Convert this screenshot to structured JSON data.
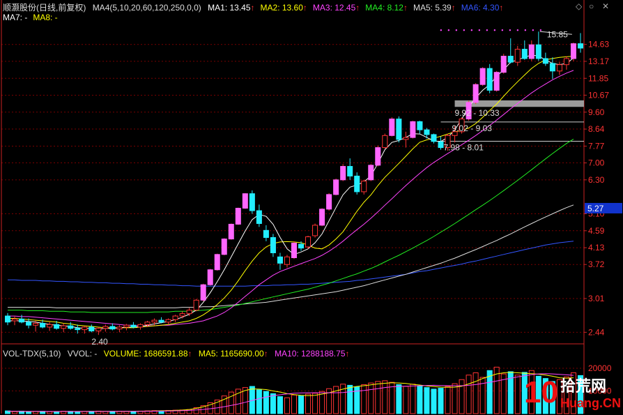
{
  "header": {
    "stock_label": "顺灏股份",
    "period": "(日线,前复权)",
    "ma_config": "MA4(5,10,20,60,120,250,0,0)",
    "ma_values": [
      {
        "label": "MA1:",
        "value": "13.45",
        "color": "#ffffff"
      },
      {
        "label": "MA2:",
        "value": "13.60",
        "color": "#ffff00"
      },
      {
        "label": "MA3:",
        "value": "12.45",
        "color": "#ff44ff"
      },
      {
        "label": "MA4:",
        "value": "8.12",
        "color": "#22ee22"
      },
      {
        "label": "MA5:",
        "value": "5.39",
        "color": "#dddddd"
      },
      {
        "label": "MA6:",
        "value": "4.30",
        "color": "#3355ff"
      }
    ],
    "ma_values_row2": [
      {
        "label": "MA7:",
        "value": "-",
        "color": "#ffffff"
      },
      {
        "label": "MA8:",
        "value": "-",
        "color": "#ffff00"
      }
    ],
    "up_arrow": "↑",
    "nav_buttons": [
      "◇",
      "○",
      "✕"
    ]
  },
  "volume_header": {
    "title": "VOL-TDX(5,10)",
    "vvol": "VVOL: -",
    "volume": {
      "label": "VOLUME:",
      "value": "1686591.88",
      "color": "#ffff00"
    },
    "ma5": {
      "label": "MA5:",
      "value": "1165690.00",
      "color": "#ffff00"
    },
    "ma10": {
      "label": "MA10:",
      "value": "1288188.75",
      "color": "#ff44ff"
    }
  },
  "price_axis_labels": [
    "14.63",
    "13.17",
    "11.85",
    "10.67",
    "9.60",
    "8.64",
    "7.77",
    "7.00",
    "6.30",
    "5.10",
    "4.59",
    "4.13",
    "3.72",
    "3.01",
    "2.44"
  ],
  "current_price_tag": "5.27",
  "volume_axis_labels": [
    "20000",
    "10000"
  ],
  "annotations": {
    "high": "15.85",
    "low": "2.40",
    "zone1": "9.92 - 10.33",
    "zone2": "9.02 - 9.03",
    "zone3": "7.98 - 8.01"
  },
  "watermark": {
    "brand_num": "10",
    "brand_name": "拾荒网",
    "url": "Huang.CN"
  },
  "colors": {
    "up": "#ff3333",
    "up_fill": "#ff66ff",
    "down": "#22eeff",
    "ma1": "#ffffff",
    "ma2": "#ffff00",
    "ma3": "#ff44ff",
    "ma4": "#22ee22",
    "ma5": "#dddddd",
    "ma6": "#3355ff",
    "grid": "#7a0000",
    "axis": "#cc2222"
  },
  "chart_data": {
    "type": "candlestick",
    "y_scale": "log",
    "ylim": [
      2.3,
      16.5
    ],
    "candles": [
      {
        "o": 2.7,
        "h": 2.75,
        "l": 2.55,
        "c": 2.6
      },
      {
        "o": 2.62,
        "h": 2.7,
        "l": 2.55,
        "c": 2.65
      },
      {
        "o": 2.65,
        "h": 2.72,
        "l": 2.58,
        "c": 2.6
      },
      {
        "o": 2.6,
        "h": 2.66,
        "l": 2.5,
        "c": 2.55
      },
      {
        "o": 2.55,
        "h": 2.62,
        "l": 2.45,
        "c": 2.58
      },
      {
        "o": 2.58,
        "h": 2.64,
        "l": 2.5,
        "c": 2.52
      },
      {
        "o": 2.52,
        "h": 2.6,
        "l": 2.46,
        "c": 2.56
      },
      {
        "o": 2.56,
        "h": 2.62,
        "l": 2.48,
        "c": 2.5
      },
      {
        "o": 2.5,
        "h": 2.58,
        "l": 2.44,
        "c": 2.54
      },
      {
        "o": 2.54,
        "h": 2.6,
        "l": 2.48,
        "c": 2.5
      },
      {
        "o": 2.5,
        "h": 2.56,
        "l": 2.42,
        "c": 2.48
      },
      {
        "o": 2.48,
        "h": 2.54,
        "l": 2.42,
        "c": 2.52
      },
      {
        "o": 2.52,
        "h": 2.56,
        "l": 2.44,
        "c": 2.46
      },
      {
        "o": 2.46,
        "h": 2.52,
        "l": 2.4,
        "c": 2.5
      },
      {
        "o": 2.5,
        "h": 2.56,
        "l": 2.45,
        "c": 2.53
      },
      {
        "o": 2.53,
        "h": 2.58,
        "l": 2.47,
        "c": 2.49
      },
      {
        "o": 2.49,
        "h": 2.55,
        "l": 2.44,
        "c": 2.52
      },
      {
        "o": 2.52,
        "h": 2.57,
        "l": 2.47,
        "c": 2.55
      },
      {
        "o": 2.55,
        "h": 2.6,
        "l": 2.5,
        "c": 2.52
      },
      {
        "o": 2.52,
        "h": 2.58,
        "l": 2.48,
        "c": 2.56
      },
      {
        "o": 2.56,
        "h": 2.62,
        "l": 2.52,
        "c": 2.6
      },
      {
        "o": 2.6,
        "h": 2.66,
        "l": 2.55,
        "c": 2.63
      },
      {
        "o": 2.63,
        "h": 2.68,
        "l": 2.58,
        "c": 2.6
      },
      {
        "o": 2.6,
        "h": 2.66,
        "l": 2.56,
        "c": 2.64
      },
      {
        "o": 2.64,
        "h": 2.72,
        "l": 2.6,
        "c": 2.7
      },
      {
        "o": 2.7,
        "h": 2.78,
        "l": 2.66,
        "c": 2.74
      },
      {
        "o": 2.74,
        "h": 2.84,
        "l": 2.7,
        "c": 2.8
      },
      {
        "o": 2.8,
        "h": 3.0,
        "l": 2.78,
        "c": 2.98
      },
      {
        "o": 2.98,
        "h": 3.3,
        "l": 2.96,
        "c": 3.28
      },
      {
        "o": 3.28,
        "h": 3.62,
        "l": 3.26,
        "c": 3.6
      },
      {
        "o": 3.6,
        "h": 3.98,
        "l": 3.58,
        "c": 3.96
      },
      {
        "o": 3.96,
        "h": 4.38,
        "l": 3.94,
        "c": 4.36
      },
      {
        "o": 4.36,
        "h": 4.8,
        "l": 4.34,
        "c": 4.78
      },
      {
        "o": 4.78,
        "h": 5.3,
        "l": 4.76,
        "c": 5.28
      },
      {
        "o": 5.28,
        "h": 5.8,
        "l": 5.26,
        "c": 5.78
      },
      {
        "o": 5.78,
        "h": 5.9,
        "l": 5.1,
        "c": 5.2
      },
      {
        "o": 5.2,
        "h": 5.4,
        "l": 4.7,
        "c": 4.8
      },
      {
        "o": 4.6,
        "h": 4.75,
        "l": 4.3,
        "c": 4.4
      },
      {
        "o": 4.4,
        "h": 4.5,
        "l": 3.9,
        "c": 4.0
      },
      {
        "o": 3.9,
        "h": 4.0,
        "l": 3.6,
        "c": 3.75
      },
      {
        "o": 3.72,
        "h": 3.95,
        "l": 3.65,
        "c": 3.9
      },
      {
        "o": 3.88,
        "h": 4.3,
        "l": 3.85,
        "c": 4.25
      },
      {
        "o": 4.22,
        "h": 4.3,
        "l": 4.05,
        "c": 4.12
      },
      {
        "o": 4.15,
        "h": 4.45,
        "l": 4.1,
        "c": 4.42
      },
      {
        "o": 4.45,
        "h": 4.8,
        "l": 4.4,
        "c": 4.75
      },
      {
        "o": 4.75,
        "h": 5.28,
        "l": 4.72,
        "c": 5.25
      },
      {
        "o": 5.25,
        "h": 5.8,
        "l": 5.2,
        "c": 5.75
      },
      {
        "o": 5.75,
        "h": 6.35,
        "l": 5.72,
        "c": 6.3
      },
      {
        "o": 6.3,
        "h": 6.95,
        "l": 6.25,
        "c": 6.85
      },
      {
        "o": 6.85,
        "h": 7.2,
        "l": 6.3,
        "c": 6.45
      },
      {
        "o": 6.45,
        "h": 6.6,
        "l": 5.75,
        "c": 5.85
      },
      {
        "o": 5.85,
        "h": 6.3,
        "l": 5.75,
        "c": 6.25
      },
      {
        "o": 6.3,
        "h": 6.95,
        "l": 6.25,
        "c": 6.9
      },
      {
        "o": 6.9,
        "h": 7.8,
        "l": 6.85,
        "c": 7.7
      },
      {
        "o": 7.7,
        "h": 8.4,
        "l": 7.65,
        "c": 8.3
      },
      {
        "o": 8.3,
        "h": 9.3,
        "l": 8.25,
        "c": 9.2
      },
      {
        "o": 9.2,
        "h": 9.35,
        "l": 7.95,
        "c": 8.1
      },
      {
        "o": 8.1,
        "h": 8.5,
        "l": 7.7,
        "c": 8.2
      },
      {
        "o": 8.2,
        "h": 9.1,
        "l": 8.15,
        "c": 9.05
      },
      {
        "o": 9.05,
        "h": 9.1,
        "l": 8.4,
        "c": 8.6
      },
      {
        "o": 8.6,
        "h": 8.7,
        "l": 8.15,
        "c": 8.35
      },
      {
        "o": 8.35,
        "h": 8.4,
        "l": 7.9,
        "c": 8.0
      },
      {
        "o": 7.98,
        "h": 8.25,
        "l": 7.6,
        "c": 7.7
      },
      {
        "o": 7.7,
        "h": 8.4,
        "l": 7.55,
        "c": 8.3
      },
      {
        "o": 8.3,
        "h": 8.8,
        "l": 7.95,
        "c": 8.5
      },
      {
        "o": 8.5,
        "h": 9.3,
        "l": 8.4,
        "c": 9.2
      },
      {
        "o": 9.2,
        "h": 10.3,
        "l": 9.1,
        "c": 10.2
      },
      {
        "o": 10.2,
        "h": 11.5,
        "l": 10.1,
        "c": 11.4
      },
      {
        "o": 11.4,
        "h": 12.7,
        "l": 11.3,
        "c": 12.6
      },
      {
        "o": 12.6,
        "h": 12.95,
        "l": 10.8,
        "c": 11.0
      },
      {
        "o": 11.0,
        "h": 12.4,
        "l": 10.9,
        "c": 12.3
      },
      {
        "o": 12.3,
        "h": 13.8,
        "l": 12.2,
        "c": 13.6
      },
      {
        "o": 13.6,
        "h": 15.2,
        "l": 13.0,
        "c": 13.1
      },
      {
        "o": 13.1,
        "h": 14.5,
        "l": 12.8,
        "c": 14.2
      },
      {
        "o": 14.2,
        "h": 15.0,
        "l": 13.3,
        "c": 13.4
      },
      {
        "o": 13.4,
        "h": 15.0,
        "l": 13.2,
        "c": 14.6
      },
      {
        "o": 14.6,
        "h": 15.85,
        "l": 13.2,
        "c": 13.4
      },
      {
        "o": 13.4,
        "h": 13.9,
        "l": 12.8,
        "c": 13.0
      },
      {
        "o": 13.0,
        "h": 13.5,
        "l": 11.8,
        "c": 12.4
      },
      {
        "o": 12.4,
        "h": 13.1,
        "l": 12.1,
        "c": 12.9
      },
      {
        "o": 12.9,
        "h": 13.6,
        "l": 12.5,
        "c": 13.4
      },
      {
        "o": 13.4,
        "h": 14.8,
        "l": 13.2,
        "c": 14.7
      },
      {
        "o": 14.7,
        "h": 15.7,
        "l": 13.9,
        "c": 14.3
      }
    ],
    "volumes": [
      1200,
      900,
      1100,
      800,
      950,
      1000,
      850,
      900,
      1050,
      1000,
      880,
      920,
      1000,
      1100,
      950,
      1000,
      1050,
      980,
      1020,
      1100,
      1200,
      1300,
      1250,
      1400,
      1500,
      1600,
      1800,
      2600,
      3500,
      4800,
      6000,
      7800,
      9500,
      10800,
      11500,
      12000,
      10500,
      9800,
      8800,
      7500,
      7000,
      8200,
      7800,
      8600,
      9000,
      9800,
      11000,
      12000,
      13000,
      12500,
      11800,
      12800,
      13500,
      14200,
      14500,
      13800,
      12800,
      12000,
      13000,
      12200,
      11500,
      10800,
      11200,
      12000,
      13200,
      15000,
      17000,
      18000,
      16000,
      19000,
      20500,
      17500,
      18500,
      17000,
      18200,
      19000,
      16500,
      15500,
      14200,
      15000,
      16200,
      18000,
      16800
    ],
    "ma1": [
      2.62,
      2.62,
      2.62,
      2.61,
      2.6,
      2.58,
      2.56,
      2.55,
      2.54,
      2.53,
      2.51,
      2.5,
      2.5,
      2.49,
      2.5,
      2.5,
      2.51,
      2.52,
      2.52,
      2.53,
      2.55,
      2.57,
      2.59,
      2.61,
      2.64,
      2.68,
      2.73,
      2.8,
      2.94,
      3.12,
      3.34,
      3.6,
      3.9,
      4.23,
      4.58,
      4.92,
      5.08,
      5.02,
      4.78,
      4.4,
      4.1,
      3.96,
      4.02,
      4.1,
      4.26,
      4.5,
      4.88,
      5.3,
      5.74,
      6.02,
      6.1,
      6.22,
      6.46,
      6.98,
      7.6,
      7.95,
      8.05,
      8.2,
      8.4,
      8.38,
      8.2,
      8.02,
      8.0,
      8.2,
      8.6,
      9.2,
      9.9,
      10.5,
      11.0,
      11.4,
      12.0,
      12.5,
      13.1,
      13.3,
      13.5,
      13.7,
      13.6,
      13.3,
      13.0,
      12.9,
      13.0,
      13.45
    ],
    "ma2": [
      2.66,
      2.66,
      2.65,
      2.64,
      2.63,
      2.62,
      2.61,
      2.6,
      2.58,
      2.57,
      2.55,
      2.54,
      2.53,
      2.52,
      2.51,
      2.51,
      2.51,
      2.51,
      2.51,
      2.52,
      2.53,
      2.54,
      2.55,
      2.56,
      2.58,
      2.6,
      2.62,
      2.66,
      2.72,
      2.8,
      2.9,
      3.02,
      3.17,
      3.36,
      3.58,
      3.8,
      4.0,
      4.15,
      4.24,
      4.28,
      4.29,
      4.28,
      4.26,
      4.2,
      4.12,
      4.1,
      4.2,
      4.36,
      4.56,
      4.86,
      5.18,
      5.48,
      5.74,
      6.08,
      6.4,
      6.68,
      6.98,
      7.3,
      7.64,
      7.96,
      8.08,
      8.16,
      8.26,
      8.38,
      8.5,
      8.56,
      8.7,
      8.94,
      9.3,
      9.7,
      10.1,
      10.6,
      11.1,
      11.6,
      12.1,
      12.6,
      13.0,
      13.3,
      13.4,
      13.5,
      13.55,
      13.6
    ],
    "ma3": [
      2.7,
      2.7,
      2.69,
      2.69,
      2.68,
      2.67,
      2.66,
      2.65,
      2.64,
      2.63,
      2.62,
      2.61,
      2.6,
      2.59,
      2.58,
      2.57,
      2.56,
      2.55,
      2.55,
      2.54,
      2.54,
      2.54,
      2.55,
      2.55,
      2.56,
      2.57,
      2.58,
      2.6,
      2.62,
      2.66,
      2.7,
      2.76,
      2.84,
      2.94,
      3.05,
      3.16,
      3.28,
      3.38,
      3.48,
      3.56,
      3.62,
      3.68,
      3.74,
      3.8,
      3.86,
      3.94,
      4.04,
      4.16,
      4.3,
      4.46,
      4.62,
      4.78,
      4.96,
      5.16,
      5.38,
      5.6,
      5.84,
      6.08,
      6.32,
      6.56,
      6.8,
      7.02,
      7.22,
      7.42,
      7.62,
      7.84,
      8.06,
      8.3,
      8.56,
      8.84,
      9.14,
      9.46,
      9.8,
      10.14,
      10.48,
      10.82,
      11.14,
      11.44,
      11.74,
      12.0,
      12.24,
      12.45
    ],
    "ma4": [
      2.8,
      2.8,
      2.8,
      2.79,
      2.79,
      2.79,
      2.78,
      2.78,
      2.78,
      2.77,
      2.77,
      2.77,
      2.76,
      2.76,
      2.76,
      2.76,
      2.76,
      2.76,
      2.76,
      2.76,
      2.76,
      2.77,
      2.77,
      2.77,
      2.78,
      2.78,
      2.78,
      2.79,
      2.8,
      2.81,
      2.83,
      2.85,
      2.87,
      2.89,
      2.92,
      2.95,
      2.98,
      3.01,
      3.04,
      3.07,
      3.1,
      3.13,
      3.16,
      3.19,
      3.23,
      3.27,
      3.31,
      3.36,
      3.41,
      3.46,
      3.51,
      3.57,
      3.63,
      3.7,
      3.78,
      3.86,
      3.94,
      4.03,
      4.12,
      4.22,
      4.32,
      4.43,
      4.55,
      4.67,
      4.8,
      4.94,
      5.08,
      5.23,
      5.38,
      5.54,
      5.71,
      5.89,
      6.08,
      6.28,
      6.49,
      6.71,
      6.94,
      7.18,
      7.42,
      7.66,
      7.9,
      8.12
    ],
    "ma5": [
      2.85,
      2.85,
      2.85,
      2.85,
      2.85,
      2.85,
      2.85,
      2.84,
      2.84,
      2.84,
      2.84,
      2.84,
      2.84,
      2.84,
      2.84,
      2.84,
      2.84,
      2.84,
      2.84,
      2.84,
      2.84,
      2.84,
      2.84,
      2.84,
      2.84,
      2.85,
      2.85,
      2.85,
      2.86,
      2.86,
      2.87,
      2.88,
      2.89,
      2.9,
      2.91,
      2.92,
      2.93,
      2.94,
      2.96,
      2.98,
      3.0,
      3.02,
      3.04,
      3.06,
      3.08,
      3.1,
      3.12,
      3.14,
      3.17,
      3.2,
      3.23,
      3.26,
      3.3,
      3.34,
      3.38,
      3.42,
      3.46,
      3.5,
      3.55,
      3.6,
      3.65,
      3.7,
      3.75,
      3.81,
      3.87,
      3.94,
      4.01,
      4.08,
      4.16,
      4.24,
      4.32,
      4.41,
      4.5,
      4.6,
      4.7,
      4.8,
      4.9,
      5.0,
      5.1,
      5.2,
      5.3,
      5.39
    ],
    "ma6": [
      3.38,
      3.38,
      3.37,
      3.37,
      3.37,
      3.36,
      3.36,
      3.35,
      3.35,
      3.34,
      3.34,
      3.33,
      3.33,
      3.32,
      3.32,
      3.31,
      3.31,
      3.3,
      3.3,
      3.29,
      3.29,
      3.28,
      3.28,
      3.27,
      3.27,
      3.26,
      3.26,
      3.25,
      3.25,
      3.25,
      3.25,
      3.25,
      3.25,
      3.25,
      3.25,
      3.26,
      3.26,
      3.26,
      3.27,
      3.27,
      3.28,
      3.28,
      3.29,
      3.29,
      3.3,
      3.31,
      3.32,
      3.33,
      3.34,
      3.35,
      3.37,
      3.38,
      3.4,
      3.42,
      3.44,
      3.46,
      3.48,
      3.5,
      3.53,
      3.56,
      3.58,
      3.61,
      3.64,
      3.67,
      3.7,
      3.73,
      3.77,
      3.8,
      3.84,
      3.88,
      3.92,
      3.96,
      4.0,
      4.04,
      4.08,
      4.12,
      4.16,
      4.2,
      4.23,
      4.26,
      4.28,
      4.3
    ],
    "vol_ma5": [
      1000,
      990,
      970,
      950,
      930,
      920,
      910,
      900,
      940,
      950,
      960,
      970,
      980,
      1000,
      1010,
      1020,
      1030,
      1040,
      1060,
      1080,
      1120,
      1180,
      1250,
      1330,
      1420,
      1550,
      1820,
      2300,
      3000,
      3900,
      5000,
      6300,
      7600,
      9000,
      10200,
      10900,
      10800,
      10600,
      10000,
      9500,
      8800,
      8400,
      8100,
      7900,
      8100,
      8600,
      9200,
      10000,
      10800,
      11500,
      12000,
      12300,
      12700,
      13100,
      13400,
      13600,
      13500,
      13300,
      12900,
      12600,
      12200,
      11900,
      11700,
      11600,
      11700,
      12100,
      13100,
      14200,
      15500,
      16500,
      17500,
      18000,
      18200,
      18000,
      17800,
      17600,
      17400,
      17000,
      16500,
      15800,
      15600,
      15800
    ],
    "vol_ma10": [
      1050,
      1040,
      1020,
      1000,
      990,
      970,
      960,
      950,
      945,
      940,
      945,
      950,
      955,
      960,
      965,
      975,
      985,
      995,
      1005,
      1020,
      1050,
      1080,
      1120,
      1170,
      1230,
      1300,
      1420,
      1600,
      1850,
      2150,
      2550,
      3050,
      3600,
      4250,
      5000,
      5800,
      6600,
      7300,
      7900,
      8300,
      8700,
      9000,
      9100,
      9200,
      9200,
      9200,
      9200,
      9200,
      9300,
      9600,
      9900,
      10200,
      10600,
      11000,
      11500,
      11800,
      12000,
      12100,
      12200,
      12300,
      12400,
      12500,
      12400,
      12300,
      12300,
      12300,
      12500,
      12800,
      13300,
      13800,
      14400,
      15000,
      15600,
      16200,
      16700,
      17200,
      17500,
      17600,
      17500,
      17300,
      17100,
      16900
    ]
  }
}
